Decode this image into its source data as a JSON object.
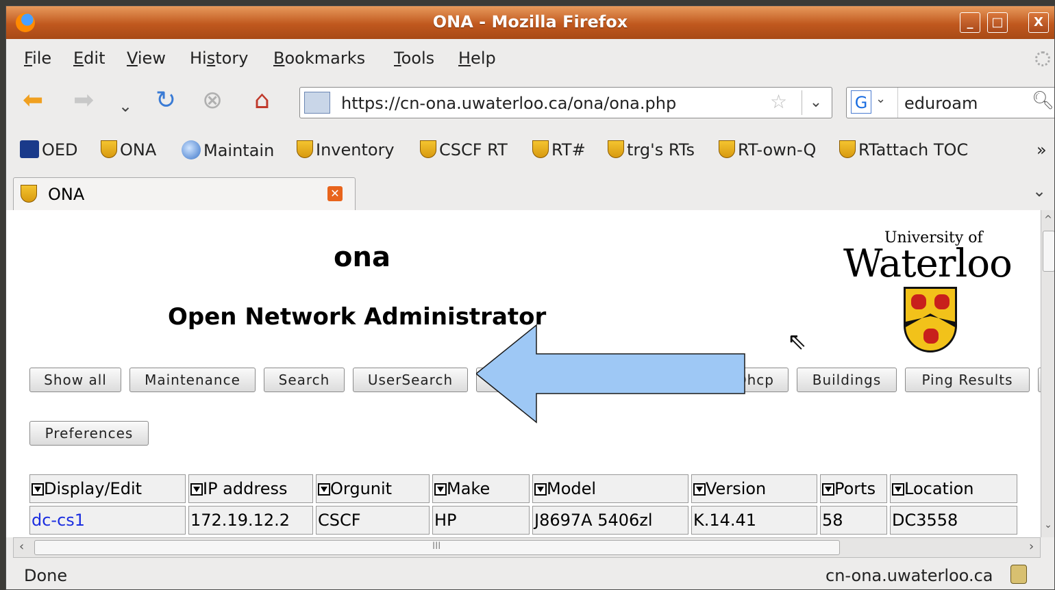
{
  "window": {
    "title": "ONA - Mozilla Firefox",
    "controls": [
      "_",
      "□",
      "X"
    ]
  },
  "menu": [
    {
      "label": "File",
      "key": "F",
      "rest": "ile"
    },
    {
      "label": "Edit",
      "key": "E",
      "rest": "dit"
    },
    {
      "label": "View",
      "key": "V",
      "rest": "iew"
    },
    {
      "label": "History",
      "pre": "Hi",
      "key": "s",
      "rest": "tory"
    },
    {
      "label": "Bookmarks",
      "key": "B",
      "rest": "ookmarks"
    },
    {
      "label": "Tools",
      "key": "T",
      "rest": "ools"
    },
    {
      "label": "Help",
      "key": "H",
      "rest": "elp"
    }
  ],
  "nav": {
    "url": "https://cn-ona.uwaterloo.ca/ona/ona.php",
    "search_value": "eduroam",
    "search_engine_glyph": "G"
  },
  "bookmarks": [
    "OED",
    "ONA",
    "Maintain",
    "Inventory",
    "CSCF RT",
    "RT#",
    "trg's RTs",
    "RT-own-Q",
    "RTattach TOC"
  ],
  "bookmarks_more": "»",
  "tab": {
    "label": "ONA"
  },
  "page": {
    "heading": "ona",
    "subheading": "Open Network Administrator",
    "logo_top": "University of",
    "logo_main": "Waterloo",
    "buttons_row1": [
      "Show all",
      "Maintenance",
      "Search",
      "UserSearch",
      "",
      "Dhcp",
      "Buildings",
      "Ping Results"
    ],
    "buttons_row2": [
      "Preferences"
    ],
    "table": {
      "headers": [
        "Display/Edit",
        "IP address",
        "Orgunit",
        "Make",
        "Model",
        "Version",
        "Ports",
        "Location"
      ],
      "rows": [
        [
          "dc-cs1",
          "172.19.12.2",
          "CSCF",
          "HP",
          "J8697A 5406zl",
          "K.14.41",
          "58",
          "DC3558"
        ]
      ]
    }
  },
  "scroll": {
    "hscroll_mid": "III"
  },
  "status": {
    "left": "Done",
    "right": "cn-ona.uwaterloo.ca"
  },
  "colors": {
    "titlebar": "#c0581e",
    "link": "#1b2ee0",
    "arrow": "#9ec8f5"
  }
}
